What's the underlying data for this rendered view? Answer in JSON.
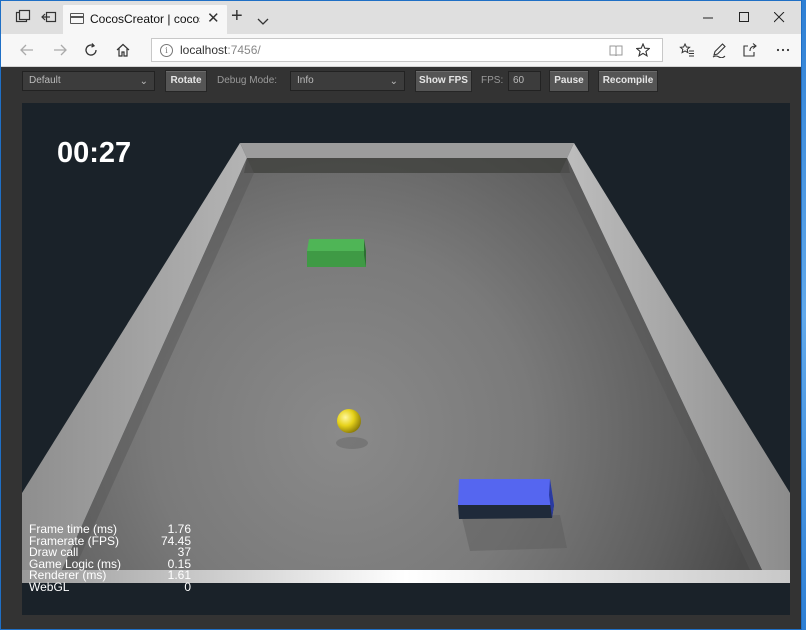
{
  "browser": {
    "tab_title": "CocosCreator | cocos-cr",
    "url_host": "localhost",
    "url_rest": ":7456/"
  },
  "toolbar": {
    "device_select": "Default",
    "rotate_label": "Rotate",
    "debug_mode_label": "Debug Mode:",
    "debug_mode_value": "Info",
    "show_fps_label": "Show FPS",
    "fps_label": "FPS:",
    "fps_value": "60",
    "pause_label": "Pause",
    "recompile_label": "Recompile"
  },
  "game": {
    "timer": "00:27",
    "stats": [
      {
        "label": "Frame time (ms)",
        "value": "1.76"
      },
      {
        "label": "Framerate (FPS)",
        "value": "74.45"
      },
      {
        "label": "Draw call",
        "value": "37"
      },
      {
        "label": "Game Logic (ms)",
        "value": "0.15"
      },
      {
        "label": "Renderer (ms)",
        "value": "1.61"
      },
      {
        "label": "WebGL",
        "value": "0"
      }
    ]
  },
  "colors": {
    "accent_blue": "#3b8ede",
    "ball": "#e6d21a",
    "green_block": "#3f9a45",
    "blue_block": "#5566f0",
    "floor": "#7a7a7a",
    "background": "#1a2229"
  }
}
